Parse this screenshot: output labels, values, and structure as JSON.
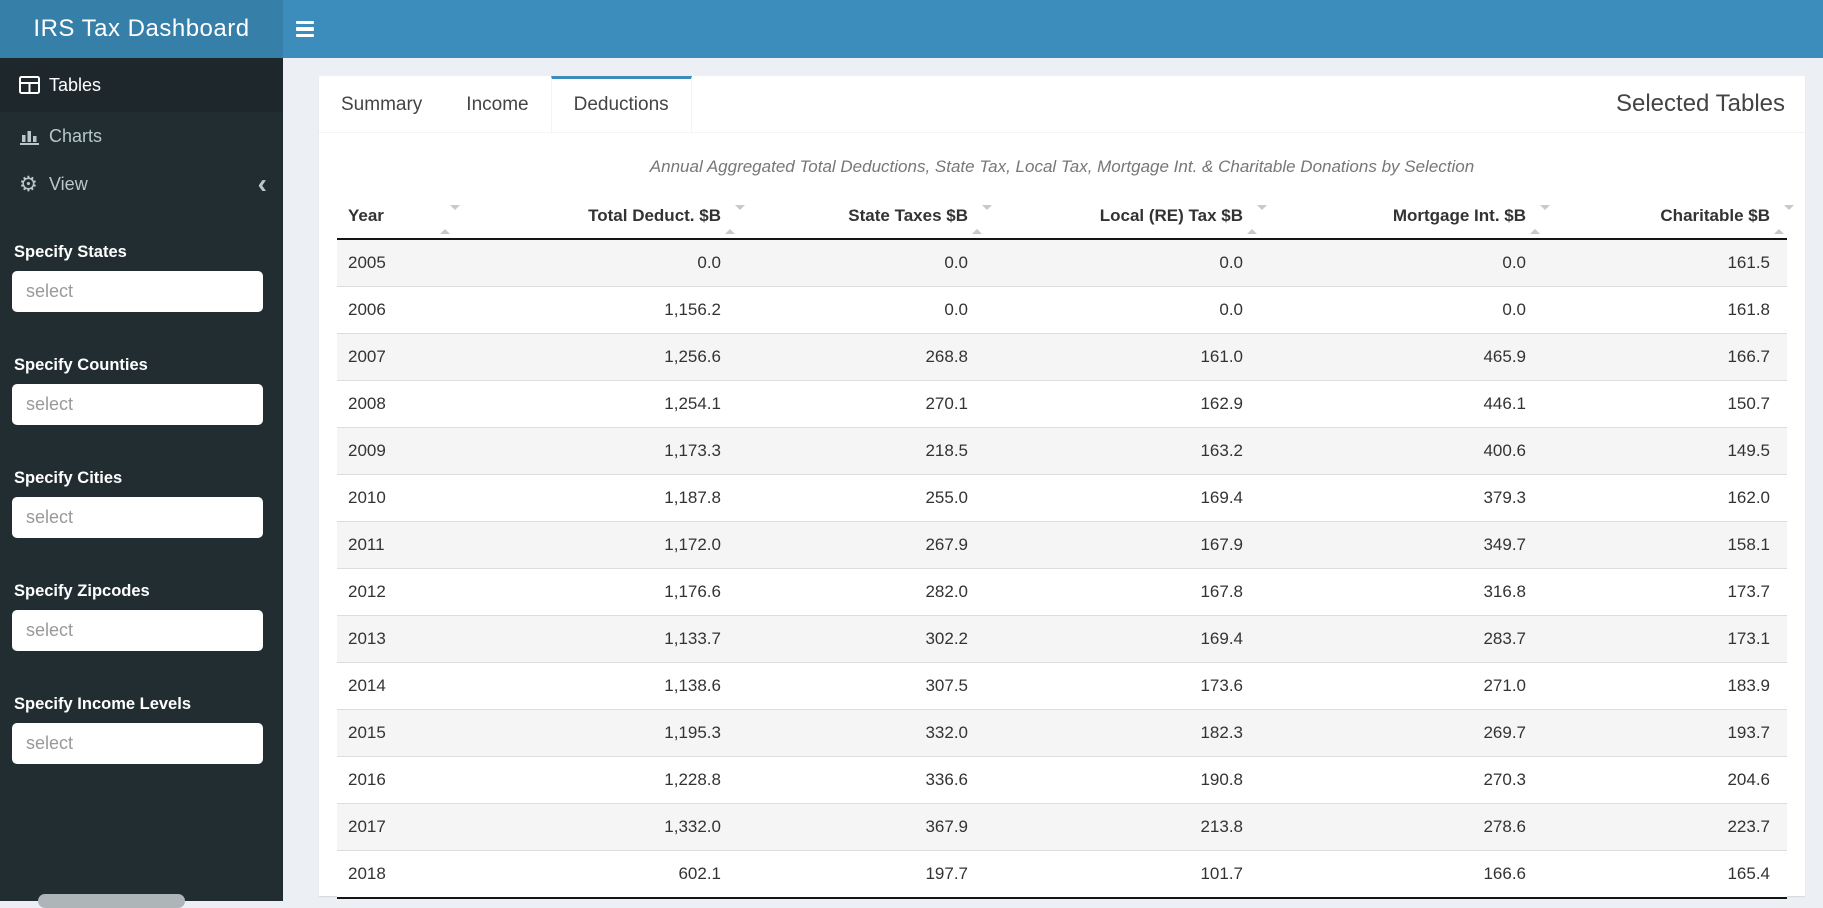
{
  "app": {
    "title": "IRS Tax Dashboard"
  },
  "navbar": {
    "toggle_icon": "hamburger-icon"
  },
  "sidebar": {
    "nav": [
      {
        "label": "Tables",
        "icon": "table-icon",
        "active": true
      },
      {
        "label": "Charts",
        "icon": "bar-chart-icon",
        "active": false
      },
      {
        "label": "View",
        "icon": "gear-icon",
        "active": false,
        "collapse_icon": "chevron-left-icon",
        "collapse_glyph": "‹"
      }
    ],
    "filters": [
      {
        "label": "Specify States",
        "placeholder": "select"
      },
      {
        "label": "Specify Counties",
        "placeholder": "select"
      },
      {
        "label": "Specify Cities",
        "placeholder": "select"
      },
      {
        "label": "Specify Zipcodes",
        "placeholder": "select"
      },
      {
        "label": "Specify Income Levels",
        "placeholder": "select"
      }
    ]
  },
  "tabs": [
    {
      "label": "Summary",
      "active": false
    },
    {
      "label": "Income",
      "active": false
    },
    {
      "label": "Deductions",
      "active": true
    }
  ],
  "panel_title": "Selected Tables",
  "table": {
    "caption": "Annual Aggregated Total Deductions, State Tax, Local Tax, Mortgage Int. & Charitable Donations by Selection",
    "sort_icon": "sort-icon",
    "columns": [
      "Year",
      "Total Deduct. $B",
      "State Taxes $B",
      "Local (RE) Tax $B",
      "Mortgage Int. $B",
      "Charitable $B"
    ],
    "rows": [
      [
        "2005",
        "0.0",
        "0.0",
        "0.0",
        "0.0",
        "161.5"
      ],
      [
        "2006",
        "1,156.2",
        "0.0",
        "0.0",
        "0.0",
        "161.8"
      ],
      [
        "2007",
        "1,256.6",
        "268.8",
        "161.0",
        "465.9",
        "166.7"
      ],
      [
        "2008",
        "1,254.1",
        "270.1",
        "162.9",
        "446.1",
        "150.7"
      ],
      [
        "2009",
        "1,173.3",
        "218.5",
        "163.2",
        "400.6",
        "149.5"
      ],
      [
        "2010",
        "1,187.8",
        "255.0",
        "169.4",
        "379.3",
        "162.0"
      ],
      [
        "2011",
        "1,172.0",
        "267.9",
        "167.9",
        "349.7",
        "158.1"
      ],
      [
        "2012",
        "1,176.6",
        "282.0",
        "167.8",
        "316.8",
        "173.7"
      ],
      [
        "2013",
        "1,133.7",
        "302.2",
        "169.4",
        "283.7",
        "173.1"
      ],
      [
        "2014",
        "1,138.6",
        "307.5",
        "173.6",
        "271.0",
        "183.9"
      ],
      [
        "2015",
        "1,195.3",
        "332.0",
        "182.3",
        "269.7",
        "193.7"
      ],
      [
        "2016",
        "1,228.8",
        "336.6",
        "190.8",
        "270.3",
        "204.6"
      ],
      [
        "2017",
        "1,332.0",
        "367.9",
        "213.8",
        "278.6",
        "223.7"
      ],
      [
        "2018",
        "602.1",
        "197.7",
        "101.7",
        "166.6",
        "165.4"
      ]
    ]
  },
  "colors": {
    "navbar": "#3c8dbc",
    "logo_bg": "#367fa9",
    "accent": "#3c8dbc",
    "sidebar_bg": "#222d32",
    "sidebar_active_bg": "#1e282c",
    "sidebar_text": "#b8c7ce",
    "content_bg": "#ecf0f5",
    "stripe": "#f5f5f5"
  }
}
